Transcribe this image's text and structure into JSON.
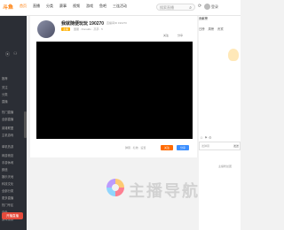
{
  "topbar": {
    "logo": "斗鱼",
    "nav": [
      "首页",
      "直播",
      "分类",
      "赛事",
      "视频",
      "游戏",
      "鱼吧",
      "三连活动"
    ],
    "search_placeholder": "搜索直播",
    "login": "登录"
  },
  "sidebar": {
    "items": [
      "推荐",
      "关注",
      "分类",
      "直播",
      "热门直播",
      "全部直播",
      "英雄联盟",
      "主机游戏",
      "单机热游",
      "网游竞技",
      "手游休闲",
      "颜值",
      "娱乐天地",
      "科技文化",
      "全部分类",
      "更多直播",
      "热门专区",
      "户外",
      "游戏视频"
    ],
    "bottom_button": "开播直播"
  },
  "room": {
    "title": "我就随便玩玩 190270",
    "subtitle": "直播间ID 190270",
    "badge": "主播",
    "meta": "国服 · Ronaldo · 高手 · 5",
    "follow": "关注",
    "share": "分享"
  },
  "player": {
    "controls_text": "弹幕 · 礼物 · 设置",
    "btn_a": "关注",
    "btn_b": "分享",
    "btn_a_color": "#ff6a00",
    "btn_b_color": "#3c8fff"
  },
  "rightpanel": {
    "rank": "贡献榜",
    "tabs": [
      "日榜",
      "周榜",
      "贵宾"
    ],
    "chat_placeholder": "发弹幕",
    "send": "发送",
    "fans": "主播粉丝团"
  },
  "watermark": {
    "text": "主播导航"
  }
}
